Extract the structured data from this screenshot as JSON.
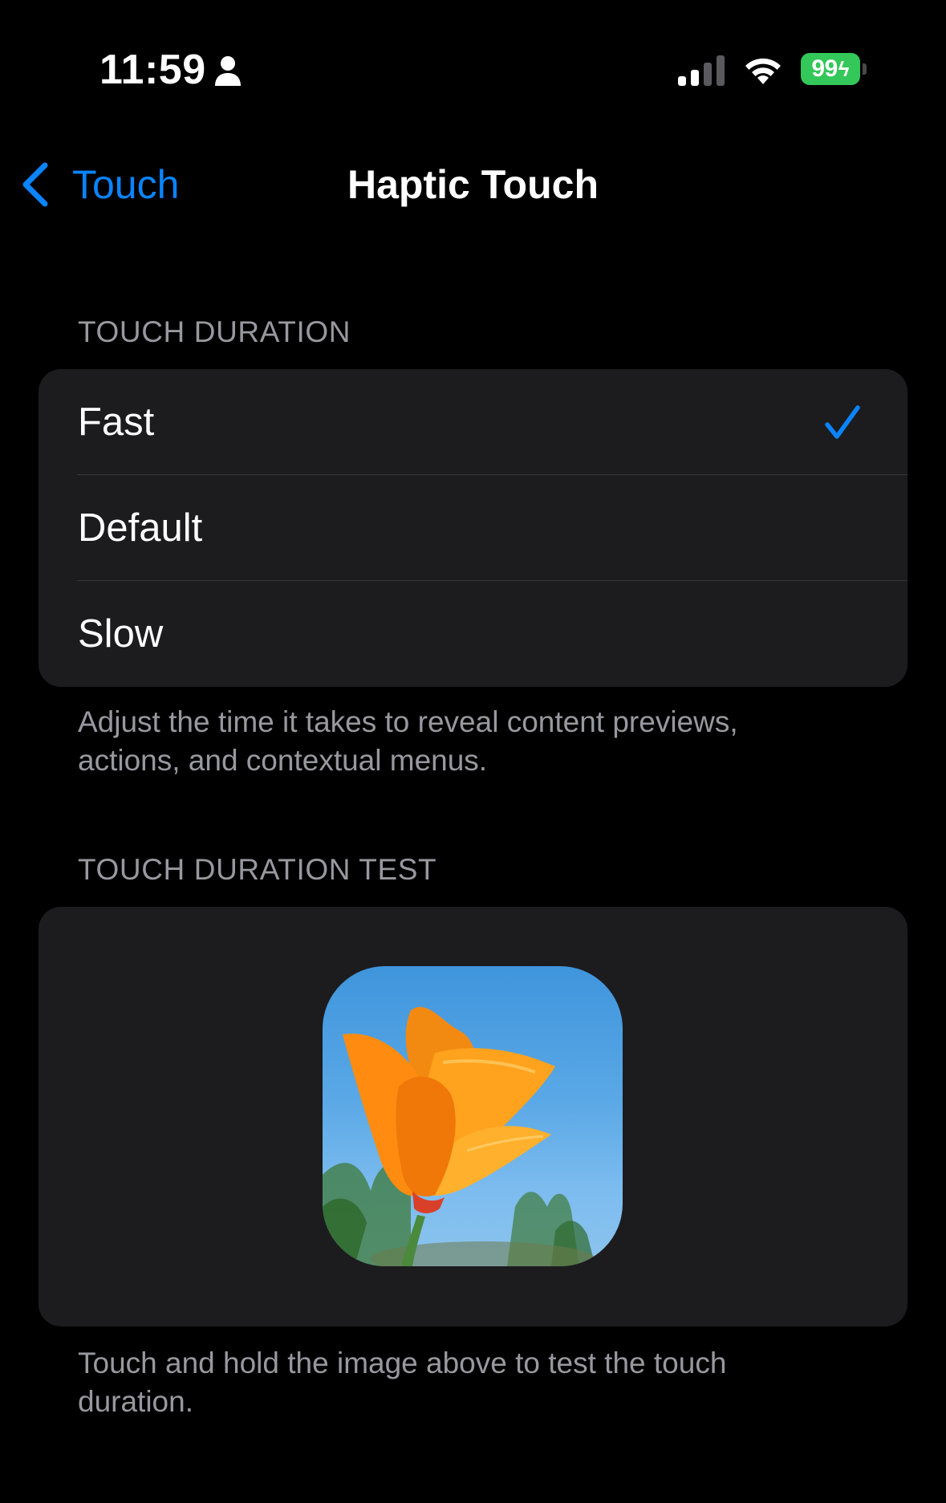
{
  "status_bar": {
    "time": "11:59",
    "battery_percent": "99",
    "battery_charging": true,
    "icons": [
      "person-icon",
      "cellular-signal-icon",
      "wifi-icon",
      "battery-icon"
    ]
  },
  "nav": {
    "back_label": "Touch",
    "title": "Haptic Touch"
  },
  "touch_duration": {
    "header": "TOUCH DURATION",
    "options": [
      {
        "label": "Fast",
        "selected": true
      },
      {
        "label": "Default",
        "selected": false
      },
      {
        "label": "Slow",
        "selected": false
      }
    ],
    "footer": "Adjust the time it takes to reveal content previews, actions, and contextual menus."
  },
  "touch_duration_test": {
    "header": "TOUCH DURATION TEST",
    "image_subject": "orange-poppy-flower",
    "footer": "Touch and hold the image above to test the touch duration."
  },
  "colors": {
    "background": "#000000",
    "group_background": "#1c1c1e",
    "accent": "#0a84ff",
    "secondary_text": "#98989f",
    "battery": "#34c759"
  }
}
